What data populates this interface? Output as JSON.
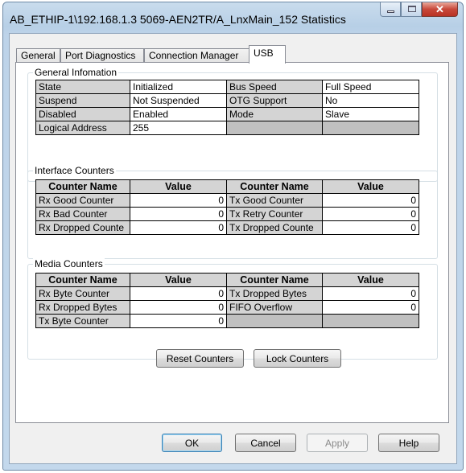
{
  "window": {
    "title": "AB_ETHIP-1\\192.168.1.3 5069-AEN2TR/A_LnxMain_152 Statistics",
    "close_glyph": "✕"
  },
  "tabs": [
    {
      "label": "General"
    },
    {
      "label": "Port Diagnostics"
    },
    {
      "label": "Connection Manager"
    },
    {
      "label": "USB"
    }
  ],
  "general_info": {
    "title": "General Infomation",
    "rows": [
      [
        "State",
        "Initialized",
        "Bus Speed",
        "Full Speed"
      ],
      [
        "Suspend",
        "Not Suspended",
        "OTG Support",
        "No"
      ],
      [
        "Disabled",
        "Enabled",
        "Mode",
        "Slave"
      ],
      [
        "Logical Address",
        "255",
        "",
        ""
      ]
    ]
  },
  "interface_counters": {
    "title": "Interface Counters",
    "headers": [
      "Counter Name",
      "Value",
      "Counter Name",
      "Value"
    ],
    "rows": [
      [
        "Rx Good Counter",
        "0",
        "Tx Good Counter",
        "0"
      ],
      [
        "Rx Bad Counter",
        "0",
        "Tx Retry Counter",
        "0"
      ],
      [
        "Rx Dropped Counte",
        "0",
        "Tx Dropped Counte",
        "0"
      ]
    ]
  },
  "media_counters": {
    "title": "Media Counters",
    "headers": [
      "Counter Name",
      "Value",
      "Counter Name",
      "Value"
    ],
    "rows": [
      [
        "Rx Byte Counter",
        "0",
        "Tx Dropped Bytes",
        "0"
      ],
      [
        "Rx Dropped Bytes",
        "0",
        "FIFO Overflow",
        "0"
      ],
      [
        "Tx Byte Counter",
        "0",
        "",
        ""
      ]
    ]
  },
  "actions": {
    "reset": "Reset Counters",
    "lock": "Lock Counters"
  },
  "footer": {
    "ok": "OK",
    "cancel": "Cancel",
    "apply": "Apply",
    "help": "Help"
  }
}
